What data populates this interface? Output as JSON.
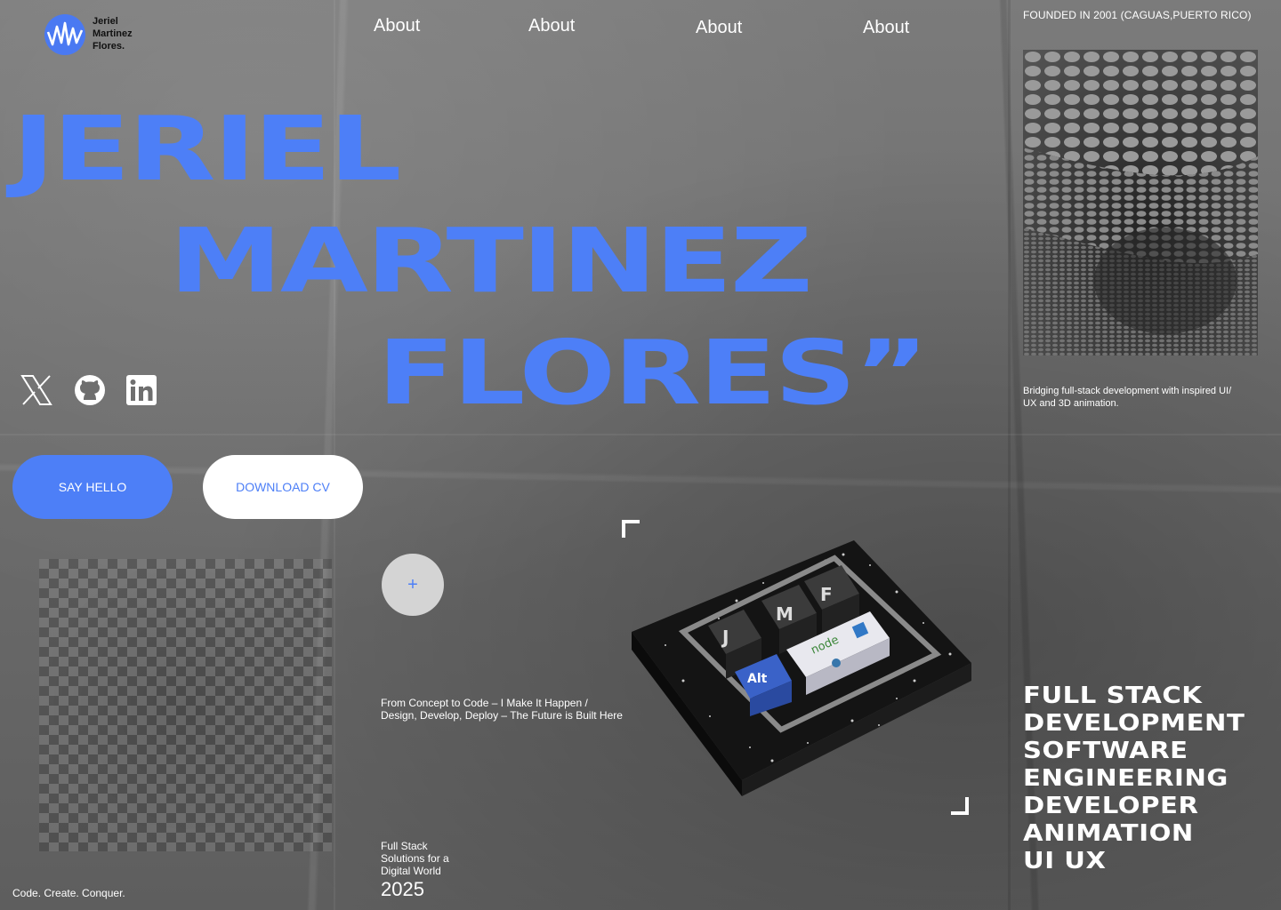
{
  "logo": {
    "name_lines": [
      "Jeriel",
      "Martinez",
      "Flores."
    ],
    "icon": "jmf-logo-icon",
    "color": "#4a79f2"
  },
  "nav": {
    "items": [
      "About",
      "About",
      "About",
      "About"
    ]
  },
  "founded": "FOUNDED IN 2001 (CAGUAS,PUERTO RICO)",
  "hero": {
    "line1": "JERIEL",
    "line2": "MARTINEZ",
    "line3": "FLORES”",
    "color": "#4d7ff7"
  },
  "social": [
    {
      "name": "x-icon"
    },
    {
      "name": "github-icon"
    },
    {
      "name": "linkedin-icon"
    }
  ],
  "buttons": {
    "primary": "SAY HELLO",
    "secondary": "DOWNLOAD CV"
  },
  "plus_label": "+",
  "tagline": {
    "line1": "From Concept to Code – I Make It Happen /",
    "line2": "Design, Develop, Deploy – The Future is Built Here"
  },
  "mini_info": {
    "lines": [
      "Full Stack",
      "Solutions for a",
      "Digital World"
    ],
    "year": "2025"
  },
  "footer_motto": "Code. Create. Conquer.",
  "bridging": {
    "line1": "Bridging full-stack development with inspired UI/",
    "line2": "UX and 3D animation."
  },
  "keyboard": {
    "keys": [
      "J",
      "M",
      "F",
      "Alt"
    ],
    "icons": [
      "node-icon",
      "typescript-icon",
      "python-icon"
    ]
  },
  "skills": [
    "FULL STACK",
    "DEVELOPMENT",
    "SOFTWARE",
    "ENGINEERING",
    "DEVELOPER",
    "ANIMATION",
    "UI UX"
  ]
}
